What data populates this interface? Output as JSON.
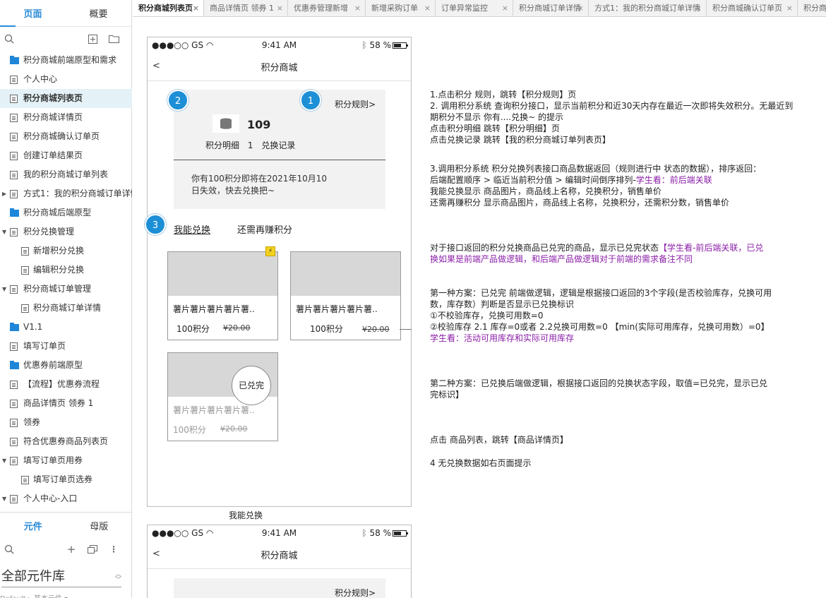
{
  "sidebar": {
    "tabs": [
      "页面",
      "概要"
    ],
    "pages": [
      {
        "label": "积分商城前端原型和需求",
        "icon": "folder",
        "indent": 0,
        "caret": false
      },
      {
        "label": "个人中心",
        "icon": "doc",
        "indent": 0,
        "caret": false
      },
      {
        "label": "积分商城列表页",
        "icon": "doc",
        "indent": 0,
        "caret": false,
        "selected": true
      },
      {
        "label": "积分商城详情页",
        "icon": "doc",
        "indent": 0,
        "caret": false
      },
      {
        "label": "积分商城确认订单页",
        "icon": "doc",
        "indent": 0,
        "caret": false
      },
      {
        "label": "创建订单结果页",
        "icon": "doc",
        "indent": 0,
        "caret": false
      },
      {
        "label": "我的积分商城订单列表",
        "icon": "doc",
        "indent": 0,
        "caret": false
      },
      {
        "label": "方式1：我的积分商城订单详情",
        "icon": "doc",
        "indent": 0,
        "caret": "right"
      },
      {
        "label": "积分商城后端原型",
        "icon": "folder",
        "indent": 0,
        "caret": false
      },
      {
        "label": "积分兑换管理",
        "icon": "doc",
        "indent": 0,
        "caret": "down"
      },
      {
        "label": "新增积分兑换",
        "icon": "doc",
        "indent": 1,
        "caret": false
      },
      {
        "label": "编辑积分兑换",
        "icon": "doc",
        "indent": 1,
        "caret": false
      },
      {
        "label": "积分商城订单管理",
        "icon": "doc",
        "indent": 0,
        "caret": "down"
      },
      {
        "label": "积分商城订单详情",
        "icon": "doc",
        "indent": 1,
        "caret": false
      },
      {
        "label": "V1.1",
        "icon": "folder",
        "indent": 0,
        "caret": false
      },
      {
        "label": "填写订单页",
        "icon": "doc",
        "indent": 0,
        "caret": false
      },
      {
        "label": "优惠券前端原型",
        "icon": "folder",
        "indent": 0,
        "caret": false
      },
      {
        "label": "【流程】优惠券流程",
        "icon": "doc",
        "indent": 0,
        "caret": false
      },
      {
        "label": "商品详情页 领券 1",
        "icon": "doc",
        "indent": 0,
        "caret": false
      },
      {
        "label": "领券",
        "icon": "doc",
        "indent": 0,
        "caret": false
      },
      {
        "label": "符合优惠券商品列表页",
        "icon": "doc",
        "indent": 0,
        "caret": false
      },
      {
        "label": "填写订单页用券",
        "icon": "doc",
        "indent": 0,
        "caret": "down"
      },
      {
        "label": "填写订单页选券",
        "icon": "doc",
        "indent": 1,
        "caret": false
      },
      {
        "label": "个人中心-入口",
        "icon": "doc",
        "indent": 0,
        "caret": "down"
      }
    ],
    "bottom_tabs": [
      "元件",
      "母版"
    ],
    "library": "全部元件库",
    "library_sub": "Default ▸ 基本元件 ▾"
  },
  "tabs": [
    {
      "label": "积分商城列表页",
      "active": true
    },
    {
      "label": "商品详情页 领券 1"
    },
    {
      "label": "优惠券管理新增"
    },
    {
      "label": "新增采购订单"
    },
    {
      "label": "订单异常监控"
    },
    {
      "label": "积分商城订单详情"
    },
    {
      "label": "方式1：我的积分商城订单详情"
    },
    {
      "label": "积分商城确认订单页"
    },
    {
      "label": "积分商城..."
    }
  ],
  "phone": {
    "carrier": "●●●○○ GS",
    "time": "9:41 AM",
    "battery": "58 %",
    "back": "<",
    "title": "积分商城",
    "rule_link": "积分规则>",
    "points": "109",
    "detail_link": "积分明细",
    "sep": "1",
    "exchange_link": "兑换记录",
    "expire_notice": "你有100积分即将在2021年10月10日失效，快去兑换把~",
    "seg_active": "我能兑换",
    "seg_other": "还需再赚积分",
    "badges": [
      "1",
      "2",
      "3"
    ],
    "products": [
      {
        "name": "薯片薯片薯片薯片薯..",
        "points": "100积分",
        "price": "¥20.00",
        "flash": true
      },
      {
        "name": "薯片薯片薯片薯片薯..",
        "points": "100积分",
        "price": "¥20.00"
      },
      {
        "name": "薯片薯片薯片薯片薯..",
        "points": "100积分",
        "price": "¥20.00",
        "soldout": "已兑完"
      }
    ]
  },
  "caption": "我能兑换",
  "phone2": {
    "carrier": "●●●○○ GS",
    "time": "9:41 AM",
    "battery": "58 %",
    "back": "<",
    "title": "积分商城",
    "rule_link": "积分规则>"
  },
  "notes": {
    "n1": [
      "1.点击积分 规则，跳转【积分规则】页",
      "2. 调用积分系统 查询积分接口，显示当前积分和近30天内存在最近一次即将失效积分。无最近到期积分不显示 你有....兑换~ 的提示",
      "点击积分明细 跳转【积分明细】页",
      "点击兑换记录 跳转【我的积分商城订单列表页】"
    ],
    "n3_a": "3.调用积分系统 积分兑换列表接口商品数据返回（规则进行中 状态的数据），排序返回：后端配置顺序 > 临近当前积分值 > 编辑时间倒序排列-",
    "n3_a_purple": "学生看：前后端关联",
    "n3_b": "我能兑换显示 商品图片，商品线上名称，兑换积分，销售单价",
    "n3_c": "还需再赚积分 显示商品图片，商品线上名称，兑换积分，还需积分数，销售单价",
    "n4_a": "对于接口返回的积分兑换商品已兑完的商品，显示已兑完状态",
    "n4_b_red": "【学生看-前后端关联，已兑换如果是前端产品做逻辑，和后端产品做逻辑对于前端的需求备注不同",
    "n5_lines": [
      "第一种方案：已兑完 前端做逻辑，逻辑是根据接口返回的3个字段(是否校验库存，兑换可用数，库存数）判断是否显示已兑换标识",
      "①不校验库存，兑换可用数=0",
      "②校验库存 2.1 库存=0或者 2.2兑换可用数=0 【min(实际可用库存，兑换可用数）=0】"
    ],
    "n5_purple": "学生看：活动可用库存和实际可用库存",
    "n6": "第二种方案：已兑换后端做逻辑，根据接口返回的兑换状态字段，取值=已兑完，显示已兑完标识】",
    "n7": "点击 商品列表，跳转【商品详情页】",
    "n8": "4 无兑换数据如右页面提示"
  }
}
